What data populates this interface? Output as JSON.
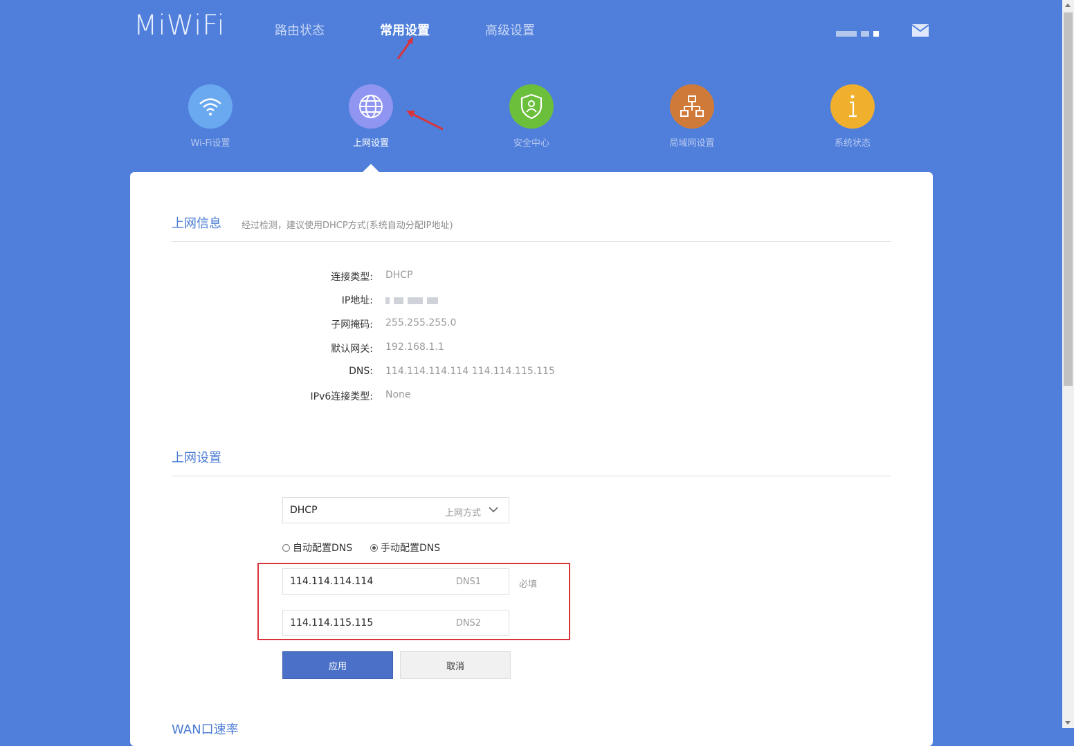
{
  "logo": "MiWiFi",
  "nav": [
    {
      "label": "路由状态"
    },
    {
      "label": "常用设置"
    },
    {
      "label": "高级设置"
    }
  ],
  "categories": [
    {
      "label": "Wi-Fi设置",
      "icon": "wifi-icon",
      "color": "#6aa9f0"
    },
    {
      "label": "上网设置",
      "icon": "globe-icon",
      "color": "#8f95f0"
    },
    {
      "label": "安全中心",
      "icon": "shield-icon",
      "color": "#6abf3b"
    },
    {
      "label": "局域网设置",
      "icon": "lan-icon",
      "color": "#d07a3a"
    },
    {
      "label": "系统状态",
      "icon": "info-icon",
      "color": "#f0b02e"
    }
  ],
  "info": {
    "title": "上网信息",
    "note": "经过检测，建议使用DHCP方式(系统自动分配IP地址)",
    "rows": [
      {
        "label": "连接类型:",
        "value": "DHCP"
      },
      {
        "label": "IP地址:",
        "value": ""
      },
      {
        "label": "子网掩码:",
        "value": "255.255.255.0"
      },
      {
        "label": "默认网关:",
        "value": "192.168.1.1"
      },
      {
        "label": "DNS:",
        "value": "114.114.114.114 114.114.115.115"
      },
      {
        "label": "IPv6连接类型:",
        "value": "None"
      }
    ]
  },
  "settings": {
    "title": "上网设置",
    "mode_value": "DHCP",
    "mode_hint": "上网方式",
    "radio_auto": "自动配置DNS",
    "radio_manual": "手动配置DNS",
    "dns1_value": "114.114.114.114",
    "dns1_hint": "DNS1",
    "dns1_required": "必填",
    "dns2_value": "114.114.115.115",
    "dns2_hint": "DNS2",
    "apply": "应用",
    "cancel": "取消"
  },
  "next_section": "WAN口速率",
  "colors": {
    "background": "#4f7fdb",
    "accent": "#4a7bd4",
    "annotation": "#d9343b"
  }
}
